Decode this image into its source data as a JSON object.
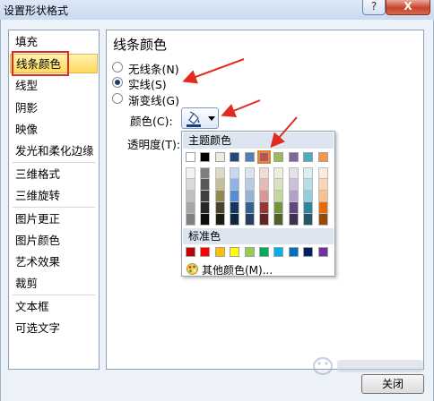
{
  "window": {
    "title": "设置形状格式",
    "help_glyph": "?",
    "close_glyph": "X"
  },
  "sidebar": {
    "items": [
      {
        "label": "填充"
      },
      {
        "label": "线条颜色",
        "selected": true
      },
      {
        "label": "线型"
      },
      {
        "label": "阴影"
      },
      {
        "label": "映像"
      },
      {
        "label": "发光和柔化边缘"
      },
      {
        "label": "三维格式"
      },
      {
        "label": "三维旋转"
      },
      {
        "label": "图片更正"
      },
      {
        "label": "图片颜色"
      },
      {
        "label": "艺术效果"
      },
      {
        "label": "裁剪"
      },
      {
        "label": "文本框"
      },
      {
        "label": "可选文字"
      }
    ]
  },
  "panel": {
    "heading": "线条颜色",
    "options": [
      {
        "label": "无线条(N)",
        "checked": false
      },
      {
        "label": "实线(S)",
        "checked": true
      },
      {
        "label": "渐变线(G)",
        "checked": false
      }
    ],
    "color_label": "颜色(C):",
    "transparency_label": "透明度(T):"
  },
  "color_popup": {
    "theme_header": "主题颜色",
    "standard_header": "标准色",
    "more_colors": "其他颜色(M)...",
    "theme_colors": [
      "#ffffff",
      "#000000",
      "#eeece1",
      "#1f497d",
      "#4f81bd",
      "#c0504d",
      "#9bbb59",
      "#8064a2",
      "#4bacc6",
      "#f79646"
    ],
    "theme_shades": [
      [
        "#f2f2f2",
        "#d9d9d9",
        "#bfbfbf",
        "#a6a6a6",
        "#808080"
      ],
      [
        "#7f7f7f",
        "#595959",
        "#404040",
        "#262626",
        "#0d0d0d"
      ],
      [
        "#ddd9c3",
        "#c4bd97",
        "#938953",
        "#494429",
        "#1d1b10"
      ],
      [
        "#c6d9f0",
        "#8db3e2",
        "#548dd4",
        "#17365d",
        "#0f243e"
      ],
      [
        "#dbe5f1",
        "#b8cce4",
        "#95b3d7",
        "#366092",
        "#244061"
      ],
      [
        "#f2dcdb",
        "#e5b9b7",
        "#d99694",
        "#953734",
        "#632423"
      ],
      [
        "#ebf1dd",
        "#d7e3bc",
        "#c3d69b",
        "#76923c",
        "#4f6128"
      ],
      [
        "#e5e0ec",
        "#ccc1d9",
        "#b2a2c7",
        "#5f497a",
        "#3f3151"
      ],
      [
        "#dbeef3",
        "#b7dde8",
        "#92cddc",
        "#31859b",
        "#205867"
      ],
      [
        "#fdeada",
        "#fbd5b5",
        "#fac08f",
        "#e36c09",
        "#974806"
      ]
    ],
    "standard_colors": [
      "#c00000",
      "#ff0000",
      "#ffc000",
      "#ffff00",
      "#92d050",
      "#00b050",
      "#00b0f0",
      "#0070c0",
      "#002060",
      "#7030a0"
    ],
    "selected_theme_index": 5
  },
  "buttons": {
    "close_label": "关闭"
  },
  "annotations": {
    "highlight_color": "#e22b1f"
  }
}
